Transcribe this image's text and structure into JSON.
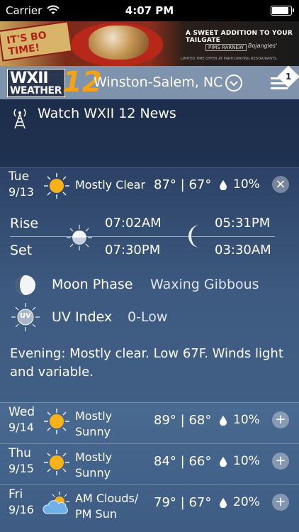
{
  "status_bar": {
    "carrier": "Carrier",
    "time": "4:07 PM",
    "battery_level": 0.9
  },
  "ad": {
    "sign_text": "IT'S BO TIME!",
    "headline": "A SWEET ADDITION TO YOUR TAILGATE",
    "logo_left": "PIMS RARNEW",
    "logo_right": "Bojangles'",
    "fine_print": "LIMITED TIME OFFER AT PARTICIPATING RESTAURANTS."
  },
  "header": {
    "logo_wxii": "WXII",
    "logo_weather": "WEATHER",
    "logo_number": "12",
    "location": "Winston-Salem, NC",
    "menu_badge": "1"
  },
  "live": {
    "label": "Watch WXII 12 News",
    "icon": "broadcast-tower-icon"
  },
  "today": {
    "day": "Tue",
    "date": "9/13",
    "icon": "sun-icon",
    "condition": "Mostly Clear",
    "high": "87°",
    "separator": "|",
    "low": "67°",
    "precip": "10%",
    "close_label": "×",
    "rise_label": "Rise",
    "set_label": "Set",
    "sunrise": "07:02AM",
    "sunset": "07:30PM",
    "moonrise": "05:31PM",
    "moonset": "03:30AM",
    "moon_phase_label": "Moon Phase",
    "moon_phase_value": "Waxing Gibbous",
    "uv_icon_text": "UV",
    "uv_label": "UV Index",
    "uv_value": "0-Low",
    "narrative": "Evening: Mostly clear. Low 67F. Winds light and variable."
  },
  "forecast": [
    {
      "day": "Wed",
      "date": "9/14",
      "icon": "sun-icon",
      "condition_line1": "Mostly",
      "condition_line2": "Sunny",
      "high": "89°",
      "separator": "|",
      "low": "68°",
      "precip": "10%",
      "expand_label": "+"
    },
    {
      "day": "Thu",
      "date": "9/15",
      "icon": "sun-icon",
      "condition_line1": "Mostly",
      "condition_line2": "Sunny",
      "high": "84°",
      "separator": "|",
      "low": "66°",
      "precip": "10%",
      "expand_label": "+"
    },
    {
      "day": "Fri",
      "date": "9/16",
      "icon": "partly-cloudy-icon",
      "condition_line1": "AM Clouds/",
      "condition_line2": "PM Sun",
      "high": "79°",
      "separator": "|",
      "low": "67°",
      "precip": "20%",
      "expand_label": "+"
    }
  ],
  "colors": {
    "sun": "#f7b21a",
    "logo_orange": "#f5a214",
    "header_bg": "#7f93ad"
  }
}
